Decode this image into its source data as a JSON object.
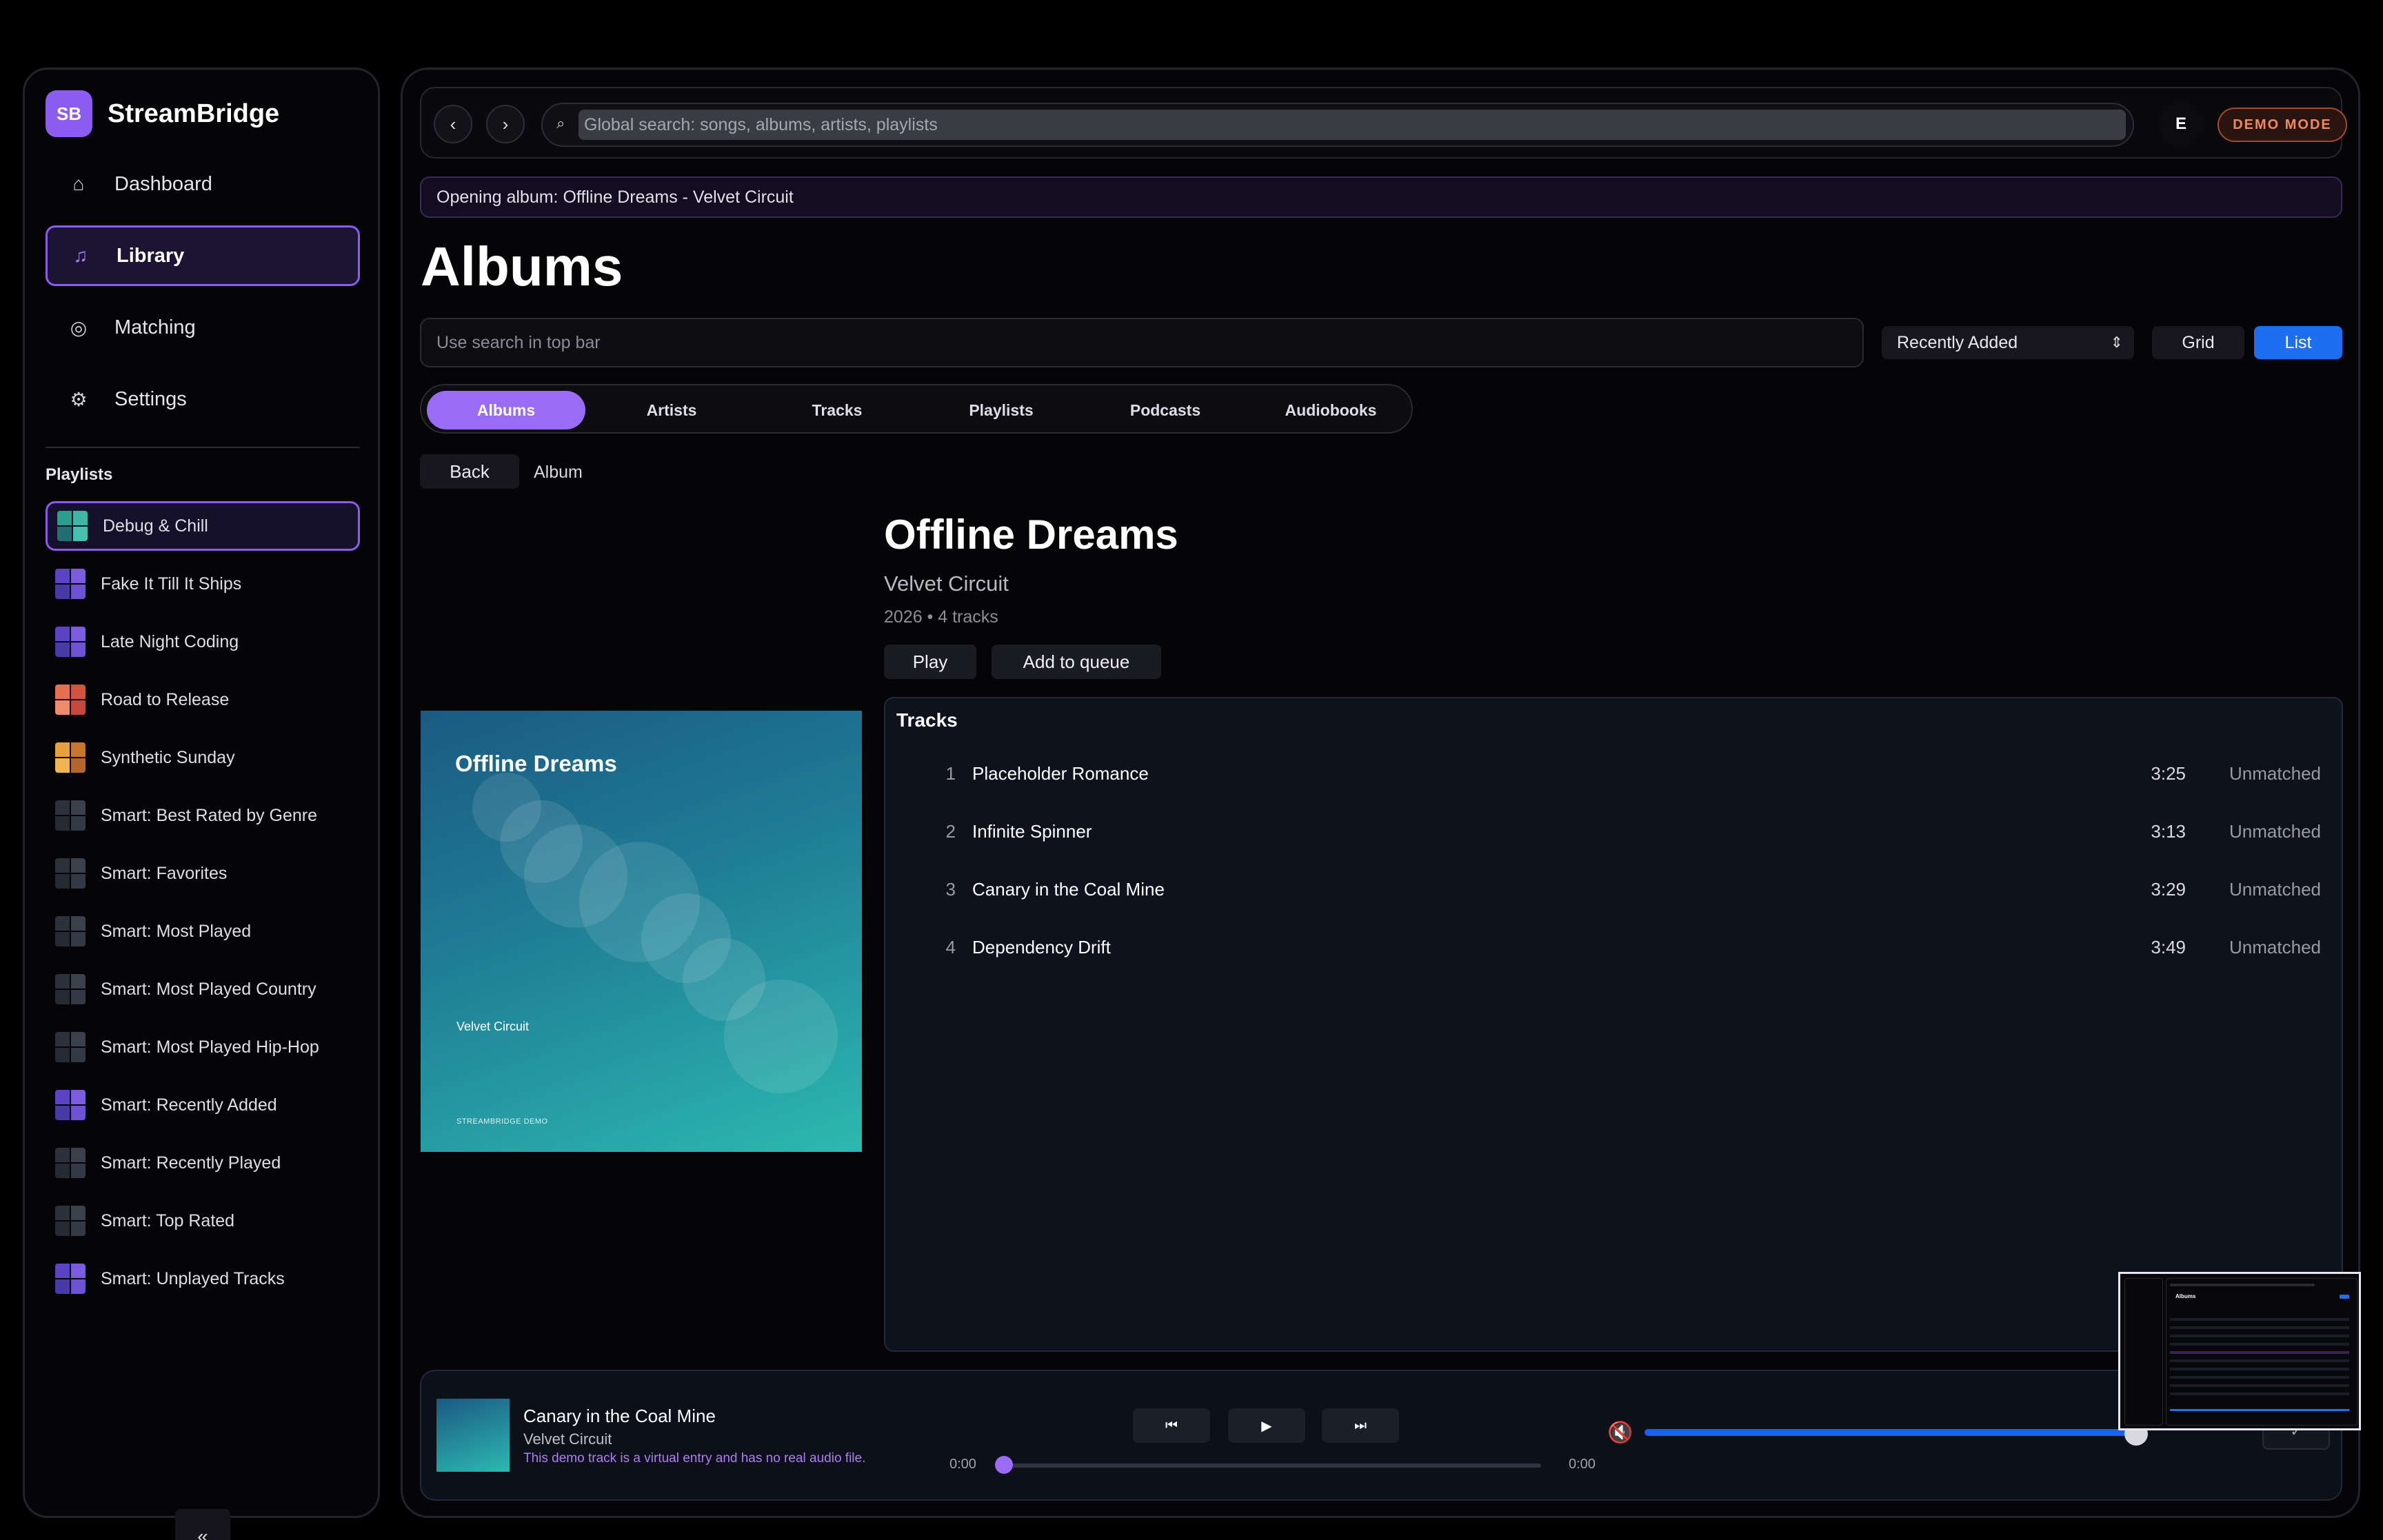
{
  "brand": {
    "logo": "SB",
    "name": "StreamBridge"
  },
  "nav": [
    {
      "icon": "home-icon",
      "glyph": "⌂",
      "label": "Dashboard",
      "active": false
    },
    {
      "icon": "music-note-icon",
      "glyph": "♫",
      "label": "Library",
      "active": true
    },
    {
      "icon": "matching-icon",
      "glyph": "◎",
      "label": "Matching",
      "active": false
    },
    {
      "icon": "gear-icon",
      "glyph": "⚙",
      "label": "Settings",
      "active": false
    }
  ],
  "playlists_title": "Playlists",
  "playlists": [
    {
      "label": "Debug & Chill",
      "active": true,
      "colors": [
        "#2a9d8f",
        "#3fb6a8",
        "#1f6f73",
        "#47c0b0"
      ]
    },
    {
      "label": "Fake It Till It Ships",
      "active": false,
      "colors": [
        "#5b43c6",
        "#7b5ce0",
        "#4a3aa8",
        "#6d52d6"
      ]
    },
    {
      "label": "Late Night Coding",
      "active": false,
      "colors": [
        "#5b43c6",
        "#7b5ce0",
        "#4a3aa8",
        "#6d52d6"
      ]
    },
    {
      "label": "Road to Release",
      "active": false,
      "colors": [
        "#e76f51",
        "#d2543f",
        "#f08a6a",
        "#c9473a"
      ]
    },
    {
      "label": "Synthetic Sunday",
      "active": false,
      "colors": [
        "#e9a13b",
        "#c9752e",
        "#f2b450",
        "#b8652c"
      ]
    },
    {
      "label": "Smart: Best Rated by Genre",
      "active": false,
      "colors": [
        "#2c313b",
        "#3a404c",
        "#262a33",
        "#343a45"
      ]
    },
    {
      "label": "Smart: Favorites",
      "active": false,
      "colors": [
        "#2c313b",
        "#3a404c",
        "#262a33",
        "#343a45"
      ]
    },
    {
      "label": "Smart: Most Played",
      "active": false,
      "colors": [
        "#2c313b",
        "#3a404c",
        "#262a33",
        "#343a45"
      ]
    },
    {
      "label": "Smart: Most Played Country",
      "active": false,
      "colors": [
        "#2c313b",
        "#3a404c",
        "#262a33",
        "#343a45"
      ]
    },
    {
      "label": "Smart: Most Played Hip-Hop",
      "active": false,
      "colors": [
        "#2c313b",
        "#3a404c",
        "#262a33",
        "#343a45"
      ]
    },
    {
      "label": "Smart: Recently Added",
      "active": false,
      "colors": [
        "#5b43c6",
        "#7b5ce0",
        "#4a3aa8",
        "#6d52d6"
      ]
    },
    {
      "label": "Smart: Recently Played",
      "active": false,
      "colors": [
        "#2c313b",
        "#3a404c",
        "#262a33",
        "#343a45"
      ]
    },
    {
      "label": "Smart: Top Rated",
      "active": false,
      "colors": [
        "#2c313b",
        "#3a404c",
        "#262a33",
        "#343a45"
      ]
    },
    {
      "label": "Smart: Unplayed Tracks",
      "active": false,
      "colors": [
        "#5b43c6",
        "#7b5ce0",
        "#4a3aa8",
        "#6d52d6"
      ]
    }
  ],
  "sidebar_collapse": "«",
  "topbar": {
    "back": "‹",
    "forward": "›",
    "search_icon": "⌕",
    "search_placeholder": "Global search: songs, albums, artists, playlists",
    "avatar": "E",
    "badge": "DEMO MODE"
  },
  "status_message": "Opening album: Offline Dreams - Velvet Circuit",
  "page_title": "Albums",
  "local_search_placeholder": "Use search in top bar",
  "sort": {
    "value": "Recently Added",
    "chevron": "⇕"
  },
  "view_toggle": {
    "grid": "Grid",
    "list": "List",
    "active": "list"
  },
  "tabs": [
    {
      "label": "Albums",
      "active": true
    },
    {
      "label": "Artists",
      "active": false
    },
    {
      "label": "Tracks",
      "active": false
    },
    {
      "label": "Playlists",
      "active": false
    },
    {
      "label": "Podcasts",
      "active": false
    },
    {
      "label": "Audiobooks",
      "active": false
    }
  ],
  "breadcrumb": {
    "back": "Back",
    "current": "Album"
  },
  "album": {
    "title": "Offline Dreams",
    "artist": "Velvet Circuit",
    "meta": "2026 • 4 tracks",
    "play": "Play",
    "queue": "Add to queue",
    "cover_title": "Offline Dreams",
    "cover_artist": "Velvet Circuit",
    "cover_brand": "STREAMBRIDGE DEMO"
  },
  "tracks_heading": "Tracks",
  "tracks": [
    {
      "num": "1",
      "title": "Placeholder Romance",
      "duration": "3:25",
      "status": "Unmatched"
    },
    {
      "num": "2",
      "title": "Infinite Spinner",
      "duration": "3:13",
      "status": "Unmatched"
    },
    {
      "num": "3",
      "title": "Canary in the Coal Mine",
      "duration": "3:29",
      "status": "Unmatched"
    },
    {
      "num": "4",
      "title": "Dependency Drift",
      "duration": "3:49",
      "status": "Unmatched"
    }
  ],
  "player": {
    "title": "Canary in the Coal Mine",
    "artist": "Velvet Circuit",
    "note": "This demo track is a virtual entry and has no real audio file.",
    "prev": "⏮",
    "play": "▶",
    "next": "⏭",
    "elapsed": "0:00",
    "total": "0:00",
    "progress": 0,
    "volume_icon": "🔇",
    "volume": 0.98,
    "extra": "✓"
  },
  "mini_preview": {
    "label": "Albums"
  },
  "colors": {
    "accent": "#8c5cf0",
    "primary_blue": "#1d6ff0",
    "badge": "#f08a5d"
  }
}
